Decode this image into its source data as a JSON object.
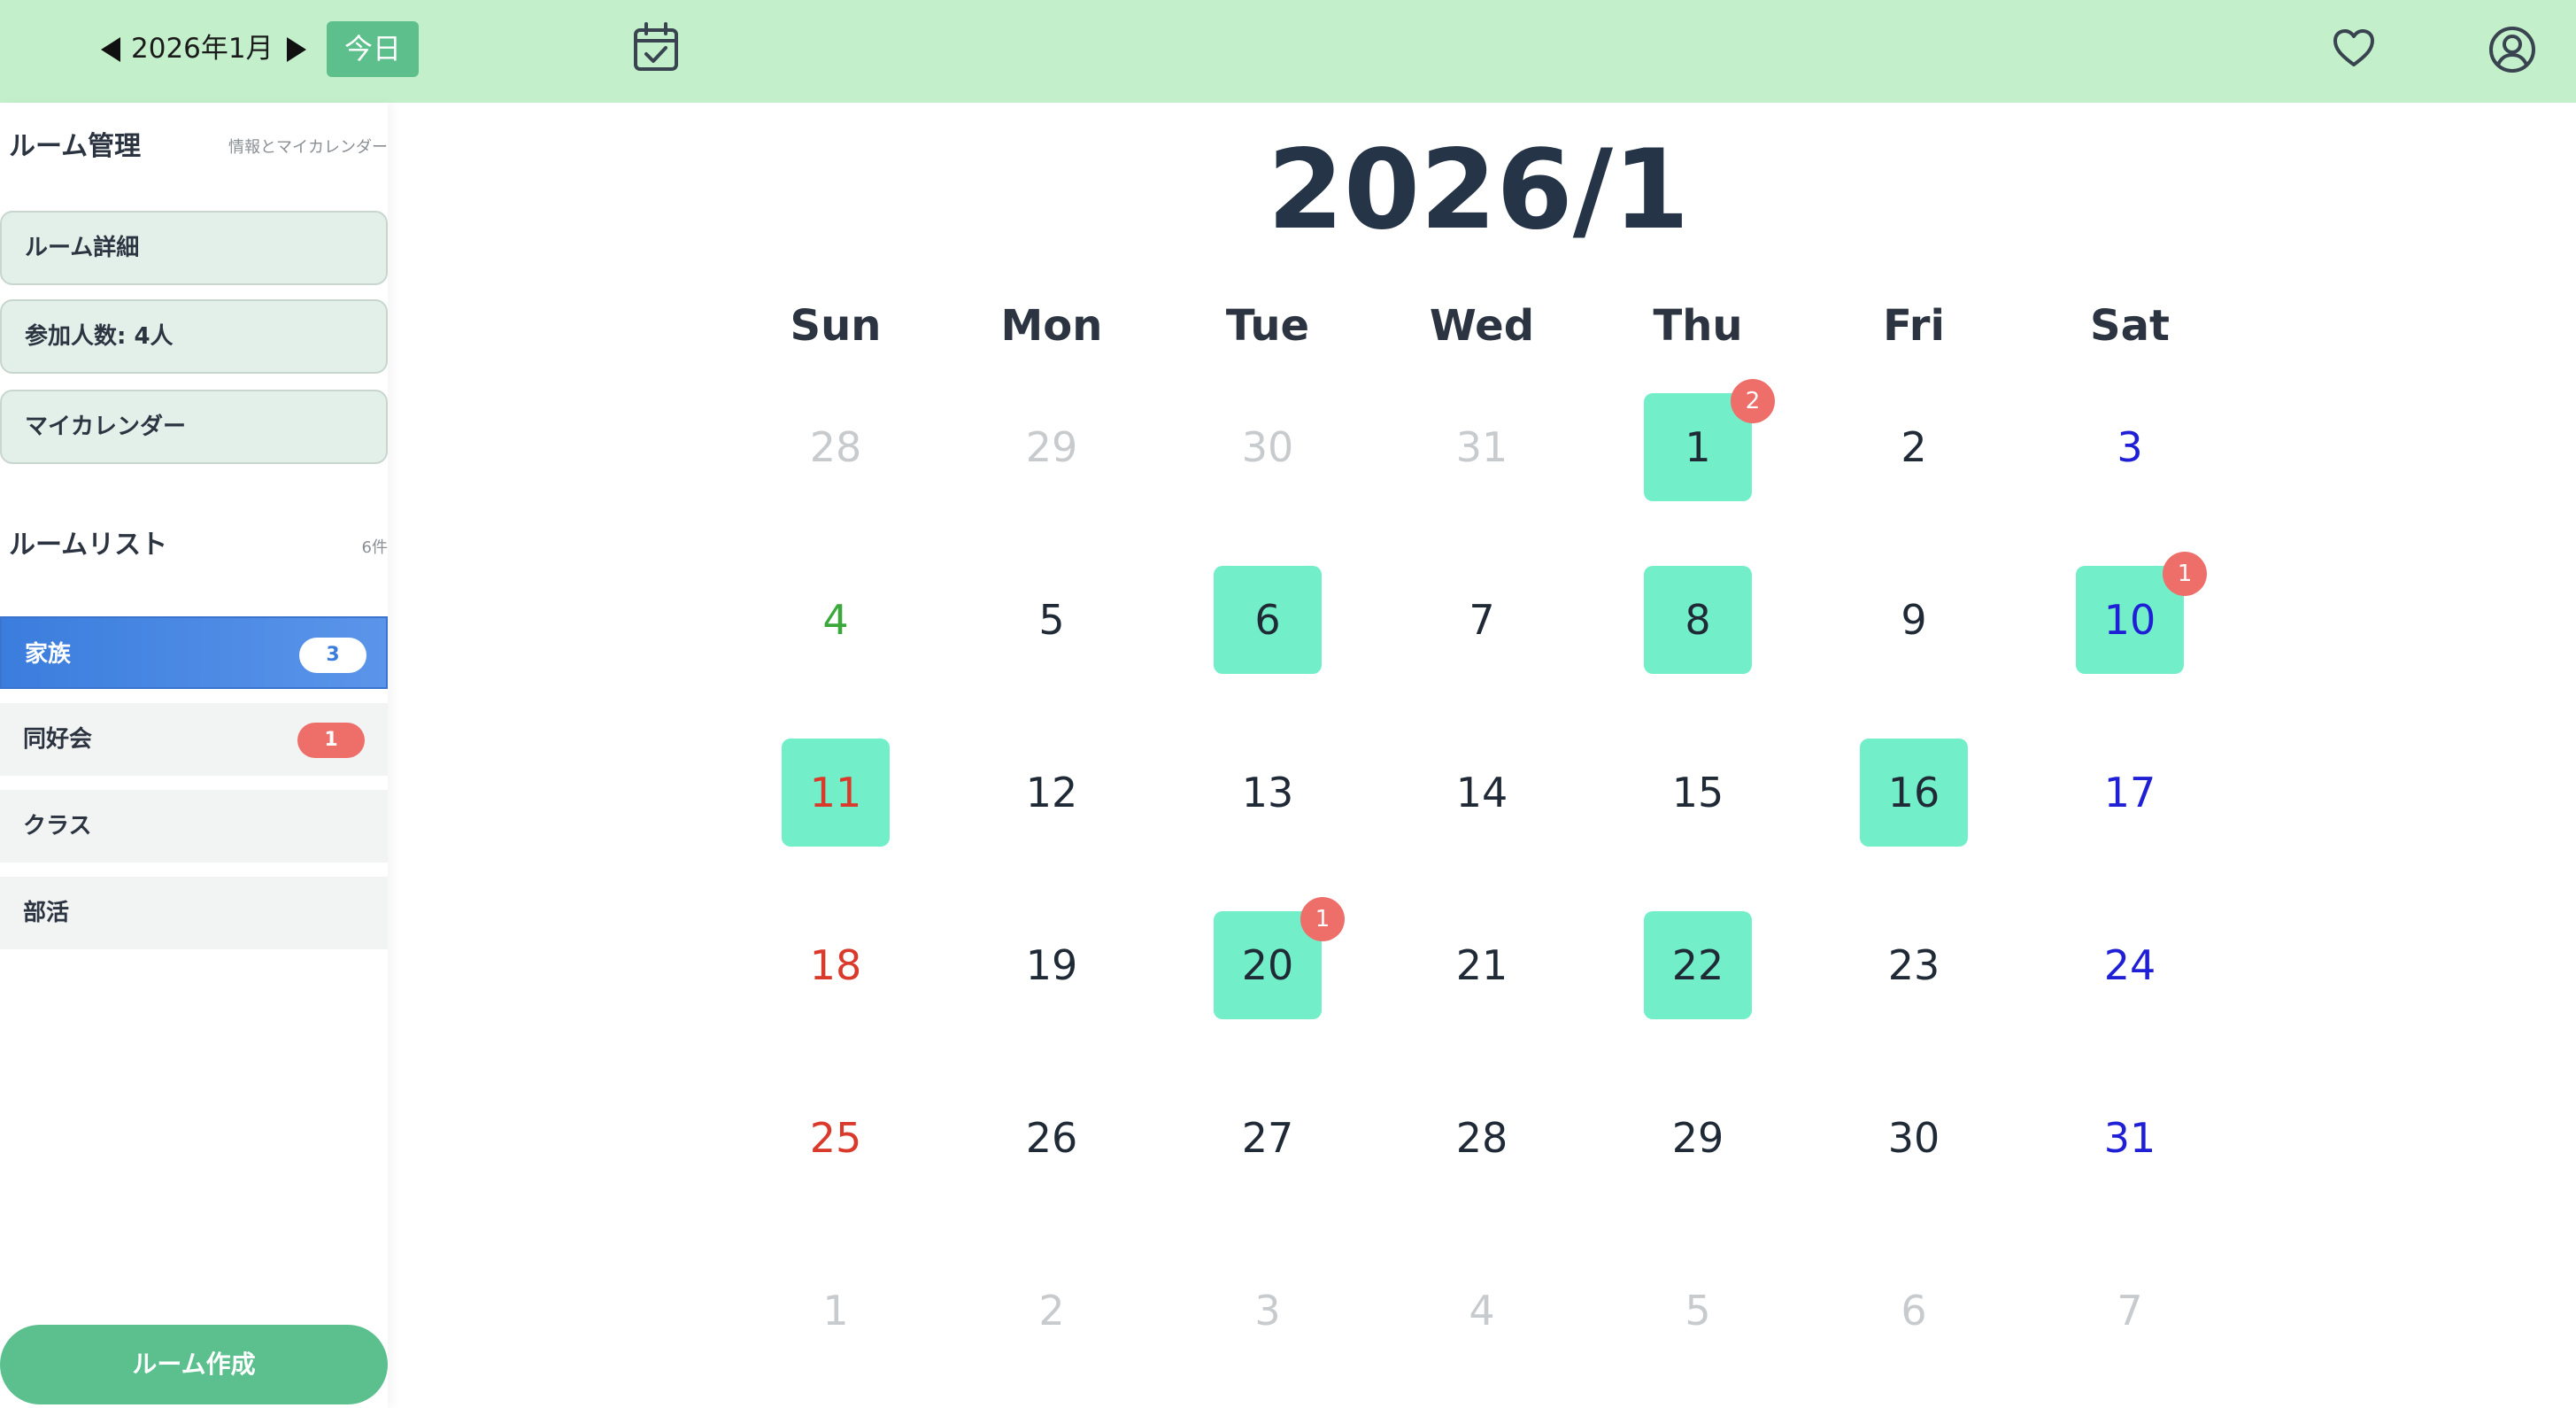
{
  "header": {
    "month_label": "2026年1月",
    "today_label": "今日",
    "icons": {
      "prev": "caret-left-icon",
      "next": "caret-right-icon",
      "calendar": "calendar-check-icon",
      "favorite": "heart-icon",
      "account": "user-circle-icon"
    }
  },
  "sidebar": {
    "room_manage": {
      "title": "ルーム管理",
      "subtitle": "情報とマイカレンダー"
    },
    "cards": {
      "room_detail": "ルーム詳細",
      "participants": "参加人数: 4人",
      "my_calendar": "マイカレンダー"
    },
    "room_list": {
      "title": "ルームリスト",
      "count": "6件",
      "items": [
        {
          "name": "家族",
          "badge": "3",
          "active": true
        },
        {
          "name": "同好会",
          "badge": "1",
          "active": false
        },
        {
          "name": "クラス",
          "badge": "",
          "active": false
        },
        {
          "name": "部活",
          "badge": "",
          "active": false
        }
      ]
    },
    "create_label": "ルーム作成"
  },
  "calendar": {
    "title": "2026/1",
    "weekdays": [
      "Sun",
      "Mon",
      "Tue",
      "Wed",
      "Thu",
      "Fri",
      "Sat"
    ],
    "weeks": [
      [
        {
          "d": "28",
          "s": "muted"
        },
        {
          "d": "29",
          "s": "muted"
        },
        {
          "d": "30",
          "s": "muted"
        },
        {
          "d": "31",
          "s": "muted"
        },
        {
          "d": "1",
          "s": "",
          "hl": true,
          "badge": "2"
        },
        {
          "d": "2",
          "s": ""
        },
        {
          "d": "3",
          "s": "sat"
        }
      ],
      [
        {
          "d": "4",
          "s": "holiday-green"
        },
        {
          "d": "5",
          "s": ""
        },
        {
          "d": "6",
          "s": "",
          "hl": true
        },
        {
          "d": "7",
          "s": ""
        },
        {
          "d": "8",
          "s": "",
          "hl": true
        },
        {
          "d": "9",
          "s": ""
        },
        {
          "d": "10",
          "s": "sat",
          "hl": true,
          "badge": "1"
        }
      ],
      [
        {
          "d": "11",
          "s": "sun",
          "hl": true
        },
        {
          "d": "12",
          "s": ""
        },
        {
          "d": "13",
          "s": ""
        },
        {
          "d": "14",
          "s": ""
        },
        {
          "d": "15",
          "s": ""
        },
        {
          "d": "16",
          "s": "",
          "hl": true
        },
        {
          "d": "17",
          "s": "sat"
        }
      ],
      [
        {
          "d": "18",
          "s": "sun"
        },
        {
          "d": "19",
          "s": ""
        },
        {
          "d": "20",
          "s": "",
          "hl": true,
          "badge": "1"
        },
        {
          "d": "21",
          "s": ""
        },
        {
          "d": "22",
          "s": "",
          "hl": true
        },
        {
          "d": "23",
          "s": ""
        },
        {
          "d": "24",
          "s": "sat"
        }
      ],
      [
        {
          "d": "25",
          "s": "sun"
        },
        {
          "d": "26",
          "s": ""
        },
        {
          "d": "27",
          "s": ""
        },
        {
          "d": "28",
          "s": ""
        },
        {
          "d": "29",
          "s": ""
        },
        {
          "d": "30",
          "s": ""
        },
        {
          "d": "31",
          "s": "sat"
        }
      ],
      [
        {
          "d": "1",
          "s": "muted"
        },
        {
          "d": "2",
          "s": "muted"
        },
        {
          "d": "3",
          "s": "muted"
        },
        {
          "d": "4",
          "s": "muted"
        },
        {
          "d": "5",
          "s": "muted"
        },
        {
          "d": "6",
          "s": "muted"
        },
        {
          "d": "7",
          "s": "muted"
        }
      ]
    ]
  },
  "colors": {
    "topbar": "#c3f0cb",
    "highlight": "#72efc8",
    "badge": "#ee6e6a",
    "accent": "#5bc08d",
    "active_room": "#3b7ddd"
  }
}
